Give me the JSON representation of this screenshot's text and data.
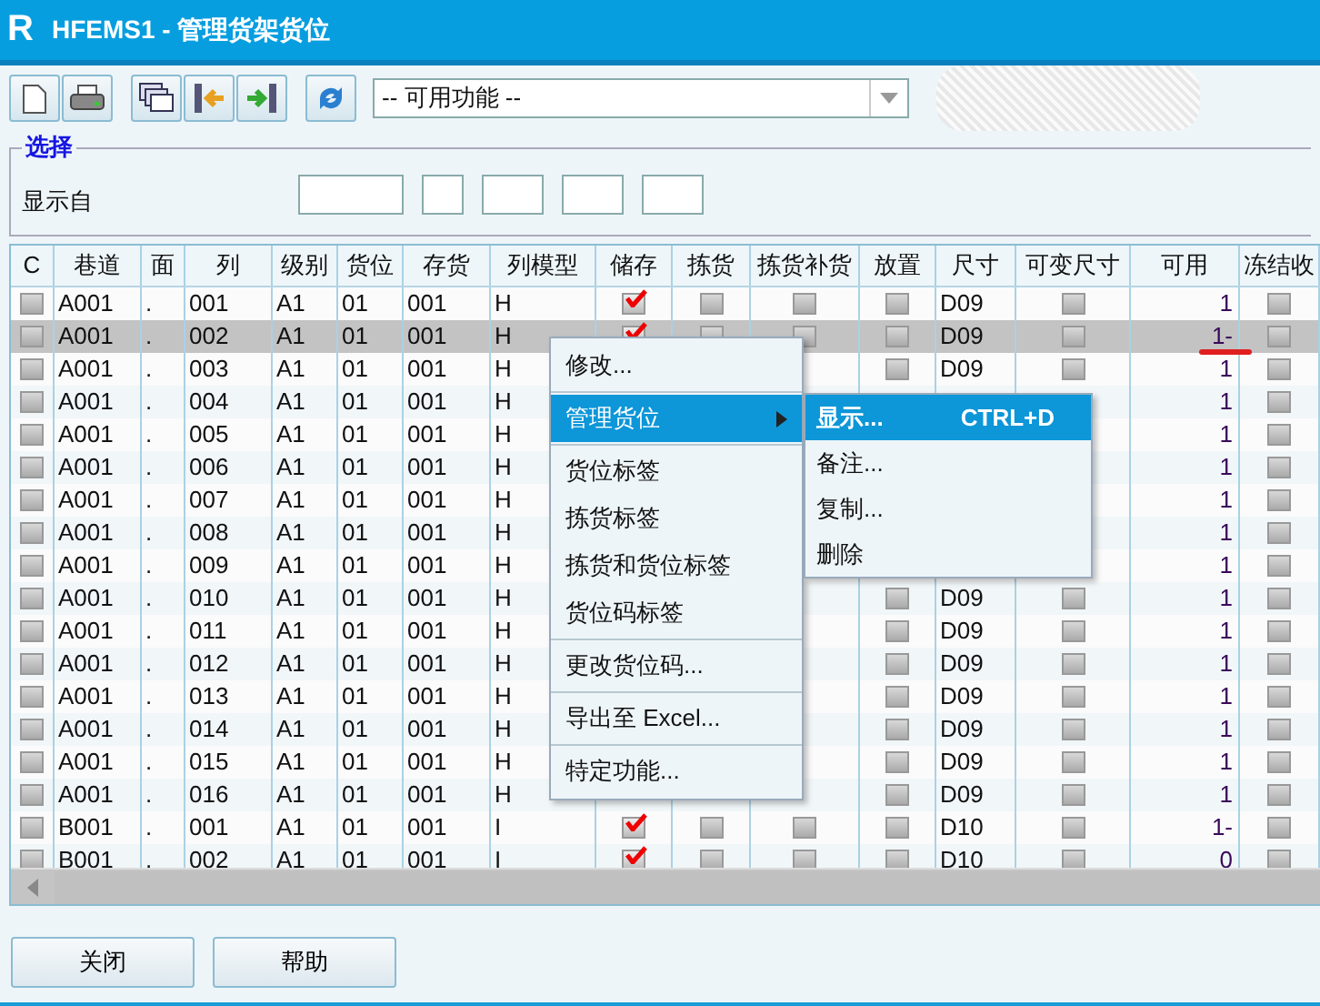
{
  "window": {
    "title": "HFEMS1 - 管理货架货位",
    "logo": "R"
  },
  "toolbar": {
    "function_select": {
      "value": "-- 可用功能 --"
    }
  },
  "selection_group": {
    "title": "选择",
    "label": "显示自"
  },
  "table": {
    "columns": [
      {
        "label": "C",
        "kind": "check"
      },
      {
        "label": "巷道",
        "kind": "text"
      },
      {
        "label": "面",
        "kind": "text"
      },
      {
        "label": "列",
        "kind": "text"
      },
      {
        "label": "级别",
        "kind": "text"
      },
      {
        "label": "货位",
        "kind": "text"
      },
      {
        "label": "存货",
        "kind": "text"
      },
      {
        "label": "列模型",
        "kind": "text"
      },
      {
        "label": "储存",
        "kind": "check"
      },
      {
        "label": "拣货",
        "kind": "check"
      },
      {
        "label": "拣货补货",
        "kind": "check"
      },
      {
        "label": "放置",
        "kind": "check"
      },
      {
        "label": "尺寸",
        "kind": "text"
      },
      {
        "label": "可变尺寸",
        "kind": "check"
      },
      {
        "label": "可用",
        "kind": "number"
      },
      {
        "label": "冻结收",
        "kind": "check"
      }
    ],
    "rows": [
      {
        "selected": false,
        "cells": [
          false,
          "A001",
          ".",
          "001",
          "A1",
          "01",
          "001",
          "H",
          true,
          false,
          false,
          false,
          "D09",
          false,
          "1",
          false
        ]
      },
      {
        "selected": true,
        "cells": [
          false,
          "A001",
          ".",
          "002",
          "A1",
          "01",
          "001",
          "H",
          true,
          false,
          false,
          false,
          "D09",
          false,
          "1-",
          false
        ]
      },
      {
        "selected": false,
        "cells": [
          false,
          "A001",
          ".",
          "003",
          "A1",
          "01",
          "001",
          "H",
          null,
          null,
          null,
          false,
          "D09",
          false,
          "1",
          false
        ]
      },
      {
        "selected": false,
        "cells": [
          false,
          "A001",
          ".",
          "004",
          "A1",
          "01",
          "001",
          "H",
          null,
          null,
          null,
          null,
          null,
          null,
          "1",
          false
        ]
      },
      {
        "selected": false,
        "cells": [
          false,
          "A001",
          ".",
          "005",
          "A1",
          "01",
          "001",
          "H",
          null,
          null,
          null,
          null,
          null,
          null,
          "1",
          false
        ]
      },
      {
        "selected": false,
        "cells": [
          false,
          "A001",
          ".",
          "006",
          "A1",
          "01",
          "001",
          "H",
          null,
          null,
          null,
          null,
          null,
          null,
          "1",
          false
        ]
      },
      {
        "selected": false,
        "cells": [
          false,
          "A001",
          ".",
          "007",
          "A1",
          "01",
          "001",
          "H",
          null,
          null,
          null,
          null,
          null,
          null,
          "1",
          false
        ]
      },
      {
        "selected": false,
        "cells": [
          false,
          "A001",
          ".",
          "008",
          "A1",
          "01",
          "001",
          "H",
          null,
          null,
          null,
          null,
          null,
          null,
          "1",
          false
        ]
      },
      {
        "selected": false,
        "cells": [
          false,
          "A001",
          ".",
          "009",
          "A1",
          "01",
          "001",
          "H",
          null,
          null,
          null,
          null,
          null,
          null,
          "1",
          false
        ]
      },
      {
        "selected": false,
        "cells": [
          false,
          "A001",
          ".",
          "010",
          "A1",
          "01",
          "001",
          "H",
          null,
          null,
          null,
          false,
          "D09",
          false,
          "1",
          false
        ]
      },
      {
        "selected": false,
        "cells": [
          false,
          "A001",
          ".",
          "011",
          "A1",
          "01",
          "001",
          "H",
          null,
          null,
          null,
          false,
          "D09",
          false,
          "1",
          false
        ]
      },
      {
        "selected": false,
        "cells": [
          false,
          "A001",
          ".",
          "012",
          "A1",
          "01",
          "001",
          "H",
          null,
          null,
          null,
          false,
          "D09",
          false,
          "1",
          false
        ]
      },
      {
        "selected": false,
        "cells": [
          false,
          "A001",
          ".",
          "013",
          "A1",
          "01",
          "001",
          "H",
          null,
          null,
          null,
          false,
          "D09",
          false,
          "1",
          false
        ]
      },
      {
        "selected": false,
        "cells": [
          false,
          "A001",
          ".",
          "014",
          "A1",
          "01",
          "001",
          "H",
          null,
          null,
          null,
          false,
          "D09",
          false,
          "1",
          false
        ]
      },
      {
        "selected": false,
        "cells": [
          false,
          "A001",
          ".",
          "015",
          "A1",
          "01",
          "001",
          "H",
          null,
          null,
          null,
          false,
          "D09",
          false,
          "1",
          false
        ]
      },
      {
        "selected": false,
        "cells": [
          false,
          "A001",
          ".",
          "016",
          "A1",
          "01",
          "001",
          "H",
          null,
          null,
          null,
          false,
          "D09",
          false,
          "1",
          false
        ]
      },
      {
        "selected": false,
        "cells": [
          false,
          "B001",
          ".",
          "001",
          "A1",
          "01",
          "001",
          "I",
          true,
          false,
          false,
          false,
          "D10",
          false,
          "1-",
          false
        ]
      },
      {
        "selected": false,
        "cells": [
          false,
          "B001",
          ".",
          "002",
          "A1",
          "01",
          "001",
          "I",
          true,
          false,
          false,
          false,
          "D10",
          false,
          "0",
          false
        ]
      }
    ]
  },
  "context_menu": {
    "items": [
      {
        "kind": "item",
        "label": "修改...",
        "selected": false
      },
      {
        "kind": "separator"
      },
      {
        "kind": "submenu",
        "label": "管理货位",
        "selected": true
      },
      {
        "kind": "separator"
      },
      {
        "kind": "item",
        "label": "货位标签",
        "selected": false
      },
      {
        "kind": "item",
        "label": "拣货标签",
        "selected": false
      },
      {
        "kind": "item",
        "label": "拣货和货位标签",
        "selected": false
      },
      {
        "kind": "item",
        "label": "货位码标签",
        "selected": false
      },
      {
        "kind": "separator"
      },
      {
        "kind": "item",
        "label": "更改货位码...",
        "selected": false
      },
      {
        "kind": "separator"
      },
      {
        "kind": "item",
        "label": "导出至 Excel...",
        "selected": false
      },
      {
        "kind": "separator"
      },
      {
        "kind": "item",
        "label": "特定功能...",
        "selected": false
      }
    ]
  },
  "submenu": {
    "items": [
      {
        "label": "显示...",
        "shortcut": "CTRL+D",
        "selected": true
      },
      {
        "label": "备注...",
        "selected": false
      },
      {
        "label": "复制...",
        "selected": false
      },
      {
        "label": "删除",
        "selected": false
      }
    ]
  },
  "buttons": [
    {
      "label": "关闭"
    },
    {
      "label": "帮助"
    }
  ]
}
